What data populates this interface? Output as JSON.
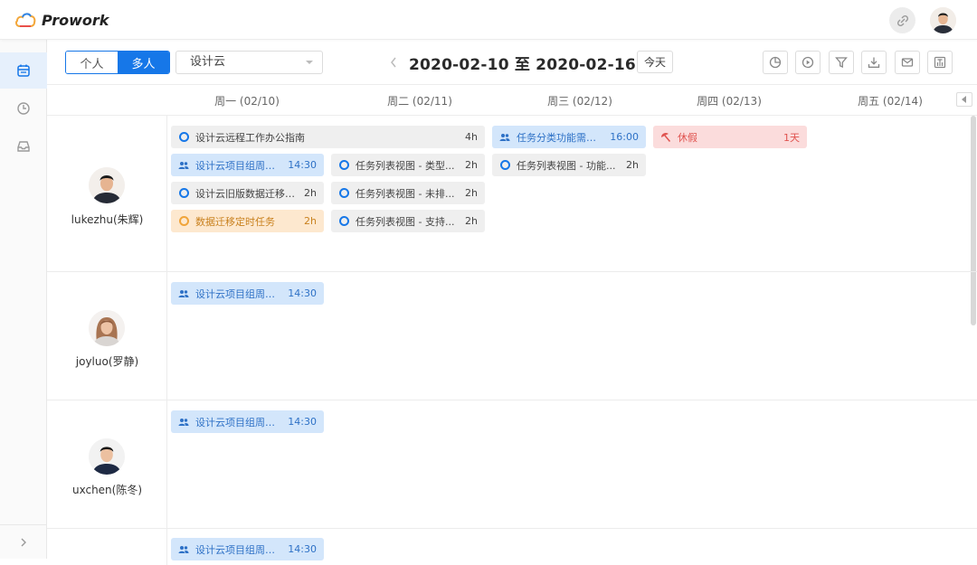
{
  "app": {
    "name": "Prowork"
  },
  "view": {
    "modes": [
      {
        "label": "个人",
        "active": false
      },
      {
        "label": "多人",
        "active": true
      }
    ],
    "project": "设计云",
    "range": "2020-02-10 至 2020-02-16",
    "today_label": "今天"
  },
  "days": [
    {
      "label": "周一 (02/10)"
    },
    {
      "label": "周二 (02/11)"
    },
    {
      "label": "周三 (02/12)"
    },
    {
      "label": "周四 (02/13)"
    },
    {
      "label": "周五 (02/14)"
    }
  ],
  "people": [
    {
      "name": "lukezhu(朱辉)",
      "tasks": [
        {
          "title": "设计云远程工作办公指南",
          "meta": "4h",
          "type": "task"
        },
        {
          "title": "设计云项目组周例会",
          "meta": "14:30",
          "type": "meeting"
        },
        {
          "title": "设计云旧版数据迁移提...",
          "meta": "2h",
          "type": "task"
        },
        {
          "title": "数据迁移定时任务",
          "meta": "2h",
          "type": "task-warn"
        },
        {
          "title": "任务列表视图 - 类型...",
          "meta": "2h",
          "type": "task"
        },
        {
          "title": "任务列表视图 - 未排...",
          "meta": "2h",
          "type": "task"
        },
        {
          "title": "任务列表视图 - 支持...",
          "meta": "2h",
          "type": "task"
        },
        {
          "title": "任务分类功能需求...",
          "meta": "16:00",
          "type": "meeting"
        },
        {
          "title": "任务列表视图 - 功能...",
          "meta": "2h",
          "type": "task"
        },
        {
          "title": "休假",
          "meta": "1天",
          "type": "leave"
        }
      ]
    },
    {
      "name": "joyluo(罗静)",
      "tasks": [
        {
          "title": "设计云项目组周例会",
          "meta": "14:30",
          "type": "meeting"
        }
      ]
    },
    {
      "name": "uxchen(陈冬)",
      "tasks": [
        {
          "title": "设计云项目组周例会",
          "meta": "14:30",
          "type": "meeting"
        }
      ]
    },
    {
      "name": "",
      "tasks": [
        {
          "title": "设计云项目组周例会",
          "meta": "14:30",
          "type": "meeting"
        }
      ]
    }
  ],
  "colors": {
    "accent": "#1677e8",
    "meeting_bg": "#d3e6fb",
    "warn_bg": "#fde8cf",
    "leave_bg": "#fbdcdc"
  },
  "icons": {
    "sidebar": [
      "calendar-icon",
      "clock-icon",
      "inbox-icon"
    ],
    "toolbar": [
      "chart-icon",
      "play-icon",
      "filter-icon",
      "download-icon",
      "mail-icon",
      "settings-icon"
    ]
  }
}
